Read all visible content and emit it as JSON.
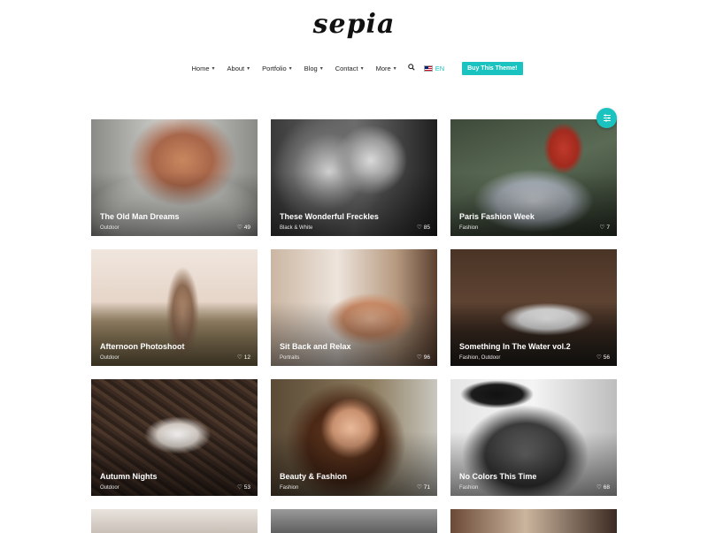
{
  "logo": {
    "text": "sepia"
  },
  "nav": {
    "items": [
      {
        "label": "Home",
        "has_dropdown": true
      },
      {
        "label": "About",
        "has_dropdown": true
      },
      {
        "label": "Portfolio",
        "has_dropdown": true
      },
      {
        "label": "Blog",
        "has_dropdown": true
      },
      {
        "label": "Contact",
        "has_dropdown": true
      },
      {
        "label": "More",
        "has_dropdown": true
      }
    ],
    "search_icon": "search-icon",
    "language": "EN",
    "buy_button": "Buy This Theme!"
  },
  "filter_button": {
    "icon": "sliders-icon"
  },
  "portfolio": {
    "items": [
      {
        "title": "The Old Man Dreams",
        "category": "Outdoor",
        "likes": "49"
      },
      {
        "title": "These Wonderful Freckles",
        "category": "Black & White",
        "likes": "85"
      },
      {
        "title": "Paris Fashion Week",
        "category": "Fashion",
        "likes": "7"
      },
      {
        "title": "Afternoon Photoshoot",
        "category": "Outdoor",
        "likes": "12"
      },
      {
        "title": "Sit Back and Relax",
        "category": "Portraits",
        "likes": "96"
      },
      {
        "title": "Something In The Water vol.2",
        "category": "Fashion, Outdoor",
        "likes": "56"
      },
      {
        "title": "Autumn Nights",
        "category": "Outdoor",
        "likes": "53"
      },
      {
        "title": "Beauty & Fashion",
        "category": "Fashion",
        "likes": "71"
      },
      {
        "title": "No Colors This Time",
        "category": "Fashion",
        "likes": "68"
      }
    ]
  },
  "colors": {
    "accent": "#1bc3c0",
    "text": "#222222",
    "background": "#ffffff"
  }
}
